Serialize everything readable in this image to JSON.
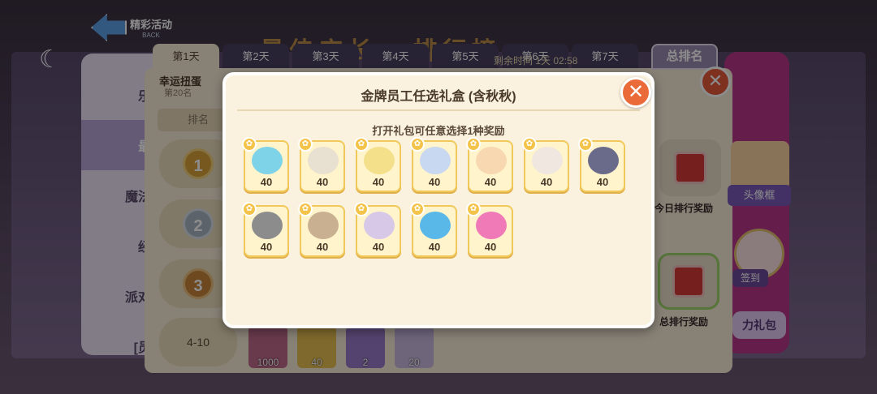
{
  "back": {
    "label": "精彩活动",
    "sub": "BACK"
  },
  "banner": "最佳店长 · 排行榜",
  "day_tabs": [
    "第1天",
    "第2天",
    "第3天",
    "第4天",
    "第5天",
    "第6天",
    "第7天"
  ],
  "countdown": "剩余时间 1天 02:58",
  "total_rank": "总排名",
  "left_nav": [
    "乐",
    "最",
    "魔法",
    "经",
    "派对",
    "[员"
  ],
  "panel": {
    "title": "幸运扭蛋",
    "subtitle": "第20名",
    "rank_header": "排名",
    "rank_range": "4-10",
    "bottom_rewards": [
      "1000",
      "40",
      "2",
      "20"
    ]
  },
  "right": {
    "today_reward": "今日排行奖励",
    "total_reward": "总排行奖励",
    "frame_label": "头像框",
    "checkin": "签到",
    "gift": "力礼包"
  },
  "modal": {
    "title": "金牌员工任选礼盒 (含秋秋)",
    "subtitle": "打开礼包可任意选择1种奖励",
    "close": "✕",
    "rewards": [
      {
        "amount": "40",
        "color": "#7fd3e8"
      },
      {
        "amount": "40",
        "color": "#e8e0d0"
      },
      {
        "amount": "40",
        "color": "#f4e08a"
      },
      {
        "amount": "40",
        "color": "#c8d8f0"
      },
      {
        "amount": "40",
        "color": "#f7d8b0"
      },
      {
        "amount": "40",
        "color": "#f0e8e0"
      },
      {
        "amount": "40",
        "color": "#6a6a8a"
      },
      {
        "amount": "40",
        "color": "#8c8c8c"
      },
      {
        "amount": "40",
        "color": "#c8b090"
      },
      {
        "amount": "40",
        "color": "#d8c8e8"
      },
      {
        "amount": "40",
        "color": "#5ab8e8"
      },
      {
        "amount": "40",
        "color": "#f07ab8"
      }
    ]
  }
}
